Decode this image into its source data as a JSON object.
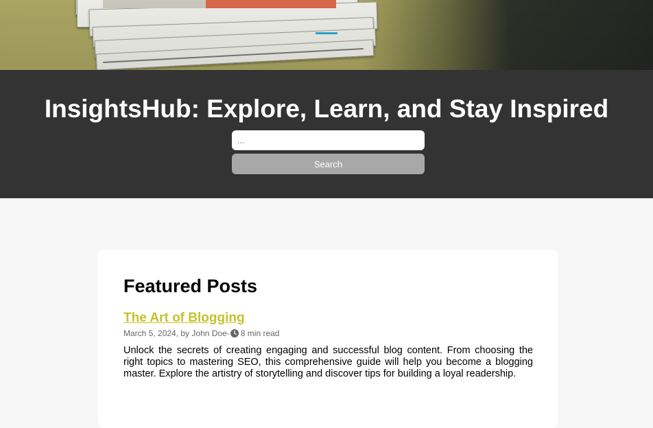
{
  "header": {
    "title": "InsightsHub: Explore, Learn, and Stay Inspired"
  },
  "search": {
    "placeholder": "...",
    "button_label": "Search"
  },
  "featured": {
    "heading": "Featured Posts",
    "posts": [
      {
        "title": "The Art of Blogging",
        "date": "March 5, 2024",
        "author_prefix": ", by ",
        "author": "John Doe",
        "separator": "-",
        "read_time": "8 min read",
        "excerpt": "Unlock the secrets of creating engaging and successful blog content. From choosing the right topics to mastering SEO, this comprehensive guide will help you become a blogging master. Explore the artistry of storytelling and discover tips for building a loyal readership."
      }
    ]
  },
  "colors": {
    "header_bg": "#333333",
    "post_link": "#c6c22c",
    "search_button": "#a8a8a8"
  }
}
